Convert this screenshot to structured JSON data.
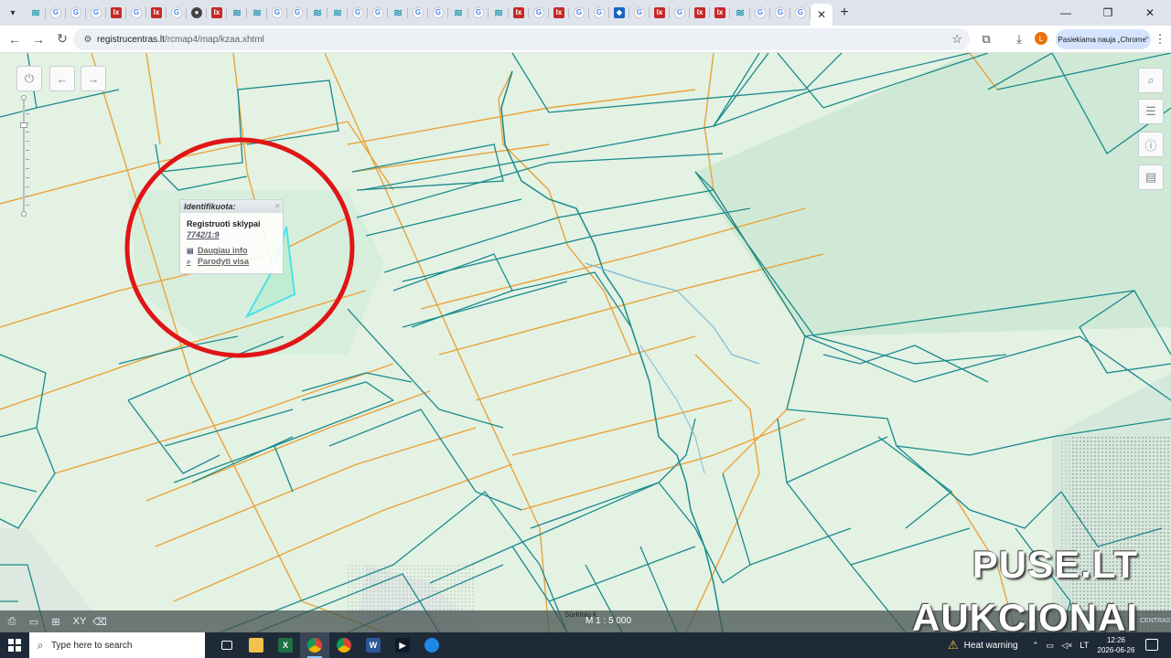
{
  "browser": {
    "url_host": "registrucentras.lt",
    "url_path": "/rcmap4/map/kzaa.xhtml",
    "update_label": "Pasiekiama nauja „Chrome“",
    "profile_initial": "L",
    "tab_favicons": [
      "rc",
      "g",
      "g",
      "g",
      "lx",
      "g",
      "lx",
      "g",
      "ck",
      "lx",
      "rc",
      "rc",
      "g",
      "g",
      "rc",
      "rc",
      "g",
      "g",
      "rc",
      "g",
      "g",
      "rc",
      "g",
      "rc",
      "lx",
      "g",
      "lx",
      "g",
      "g",
      "blue",
      "g",
      "lx",
      "g",
      "lx",
      "lx",
      "rc",
      "g",
      "g",
      "g"
    ]
  },
  "map": {
    "popup": {
      "title": "Identifikuota:",
      "close": "×",
      "layer": "Registruoti sklypai",
      "parcel_id": "7742/1:9",
      "more_info": "Daugiau info",
      "show_all": "Parodyti visa"
    },
    "scale_label": "M 1 : 5 000",
    "scale_behind": "Sūrkinių k.",
    "centras_text": "CENTRAS",
    "highlight_color": "#e01515",
    "parcel_line_color": "#1a8a8c",
    "boundary_line_color": "#eba23a",
    "selected_parcel_color": "#4be3e8"
  },
  "watermark": {
    "line1": "PUSE.LT",
    "line2": "AUKCIONAI"
  },
  "taskbar": {
    "search_placeholder": "Type here to search",
    "heat_label": "Heat warning",
    "lang": "LT",
    "time": "12:26",
    "date": "2026-06-26"
  }
}
